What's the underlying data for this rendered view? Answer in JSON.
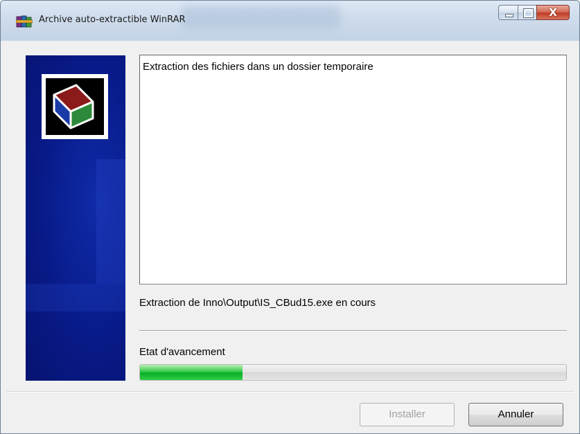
{
  "window": {
    "title": "Archive auto-extractible WinRAR",
    "icon": "winrar-books-icon",
    "controls": {
      "minimize_icon": "minimize-icon",
      "maximize_icon": "maximize-icon",
      "close_icon": "close-icon",
      "close_glyph": "X"
    }
  },
  "banner": {
    "logo_icon": "archive-box-icon",
    "colors": {
      "background": "#081a88",
      "box_top": "#8b1a1a",
      "box_side": "#2c8a3a"
    }
  },
  "log": {
    "lines": [
      "Extraction des fichiers dans un dossier temporaire"
    ]
  },
  "status": {
    "text": "Extraction de Inno\\Output\\IS_CBud15.exe en cours"
  },
  "progress": {
    "label": "Etat d'avancement",
    "percent": 24,
    "color": "#06b025"
  },
  "buttons": {
    "install_label": "Installer",
    "install_enabled": false,
    "cancel_label": "Annuler"
  }
}
